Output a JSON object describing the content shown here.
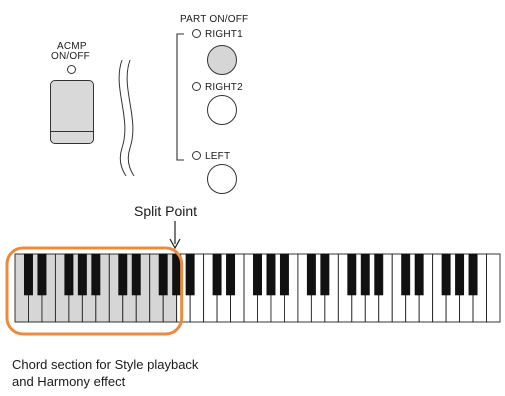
{
  "acmp": {
    "label_line1": "ACMP",
    "label_line2": "ON/OFF"
  },
  "part": {
    "title": "PART ON/OFF",
    "buttons": [
      {
        "label": "RIGHT1",
        "state": "on"
      },
      {
        "label": "RIGHT2",
        "state": "off"
      },
      {
        "label": "LEFT",
        "state": "off"
      }
    ]
  },
  "split": {
    "label": "Split Point"
  },
  "caption": {
    "line1": "Chord section for Style playback",
    "line2": "and Harmony effect"
  },
  "keyboard": {
    "white_keys": 36,
    "chord_section_white_keys": 12
  },
  "colors": {
    "highlight": "#ee8a3c",
    "shaded_key": "#d6d6d6",
    "button_on": "#d6d6d6"
  }
}
